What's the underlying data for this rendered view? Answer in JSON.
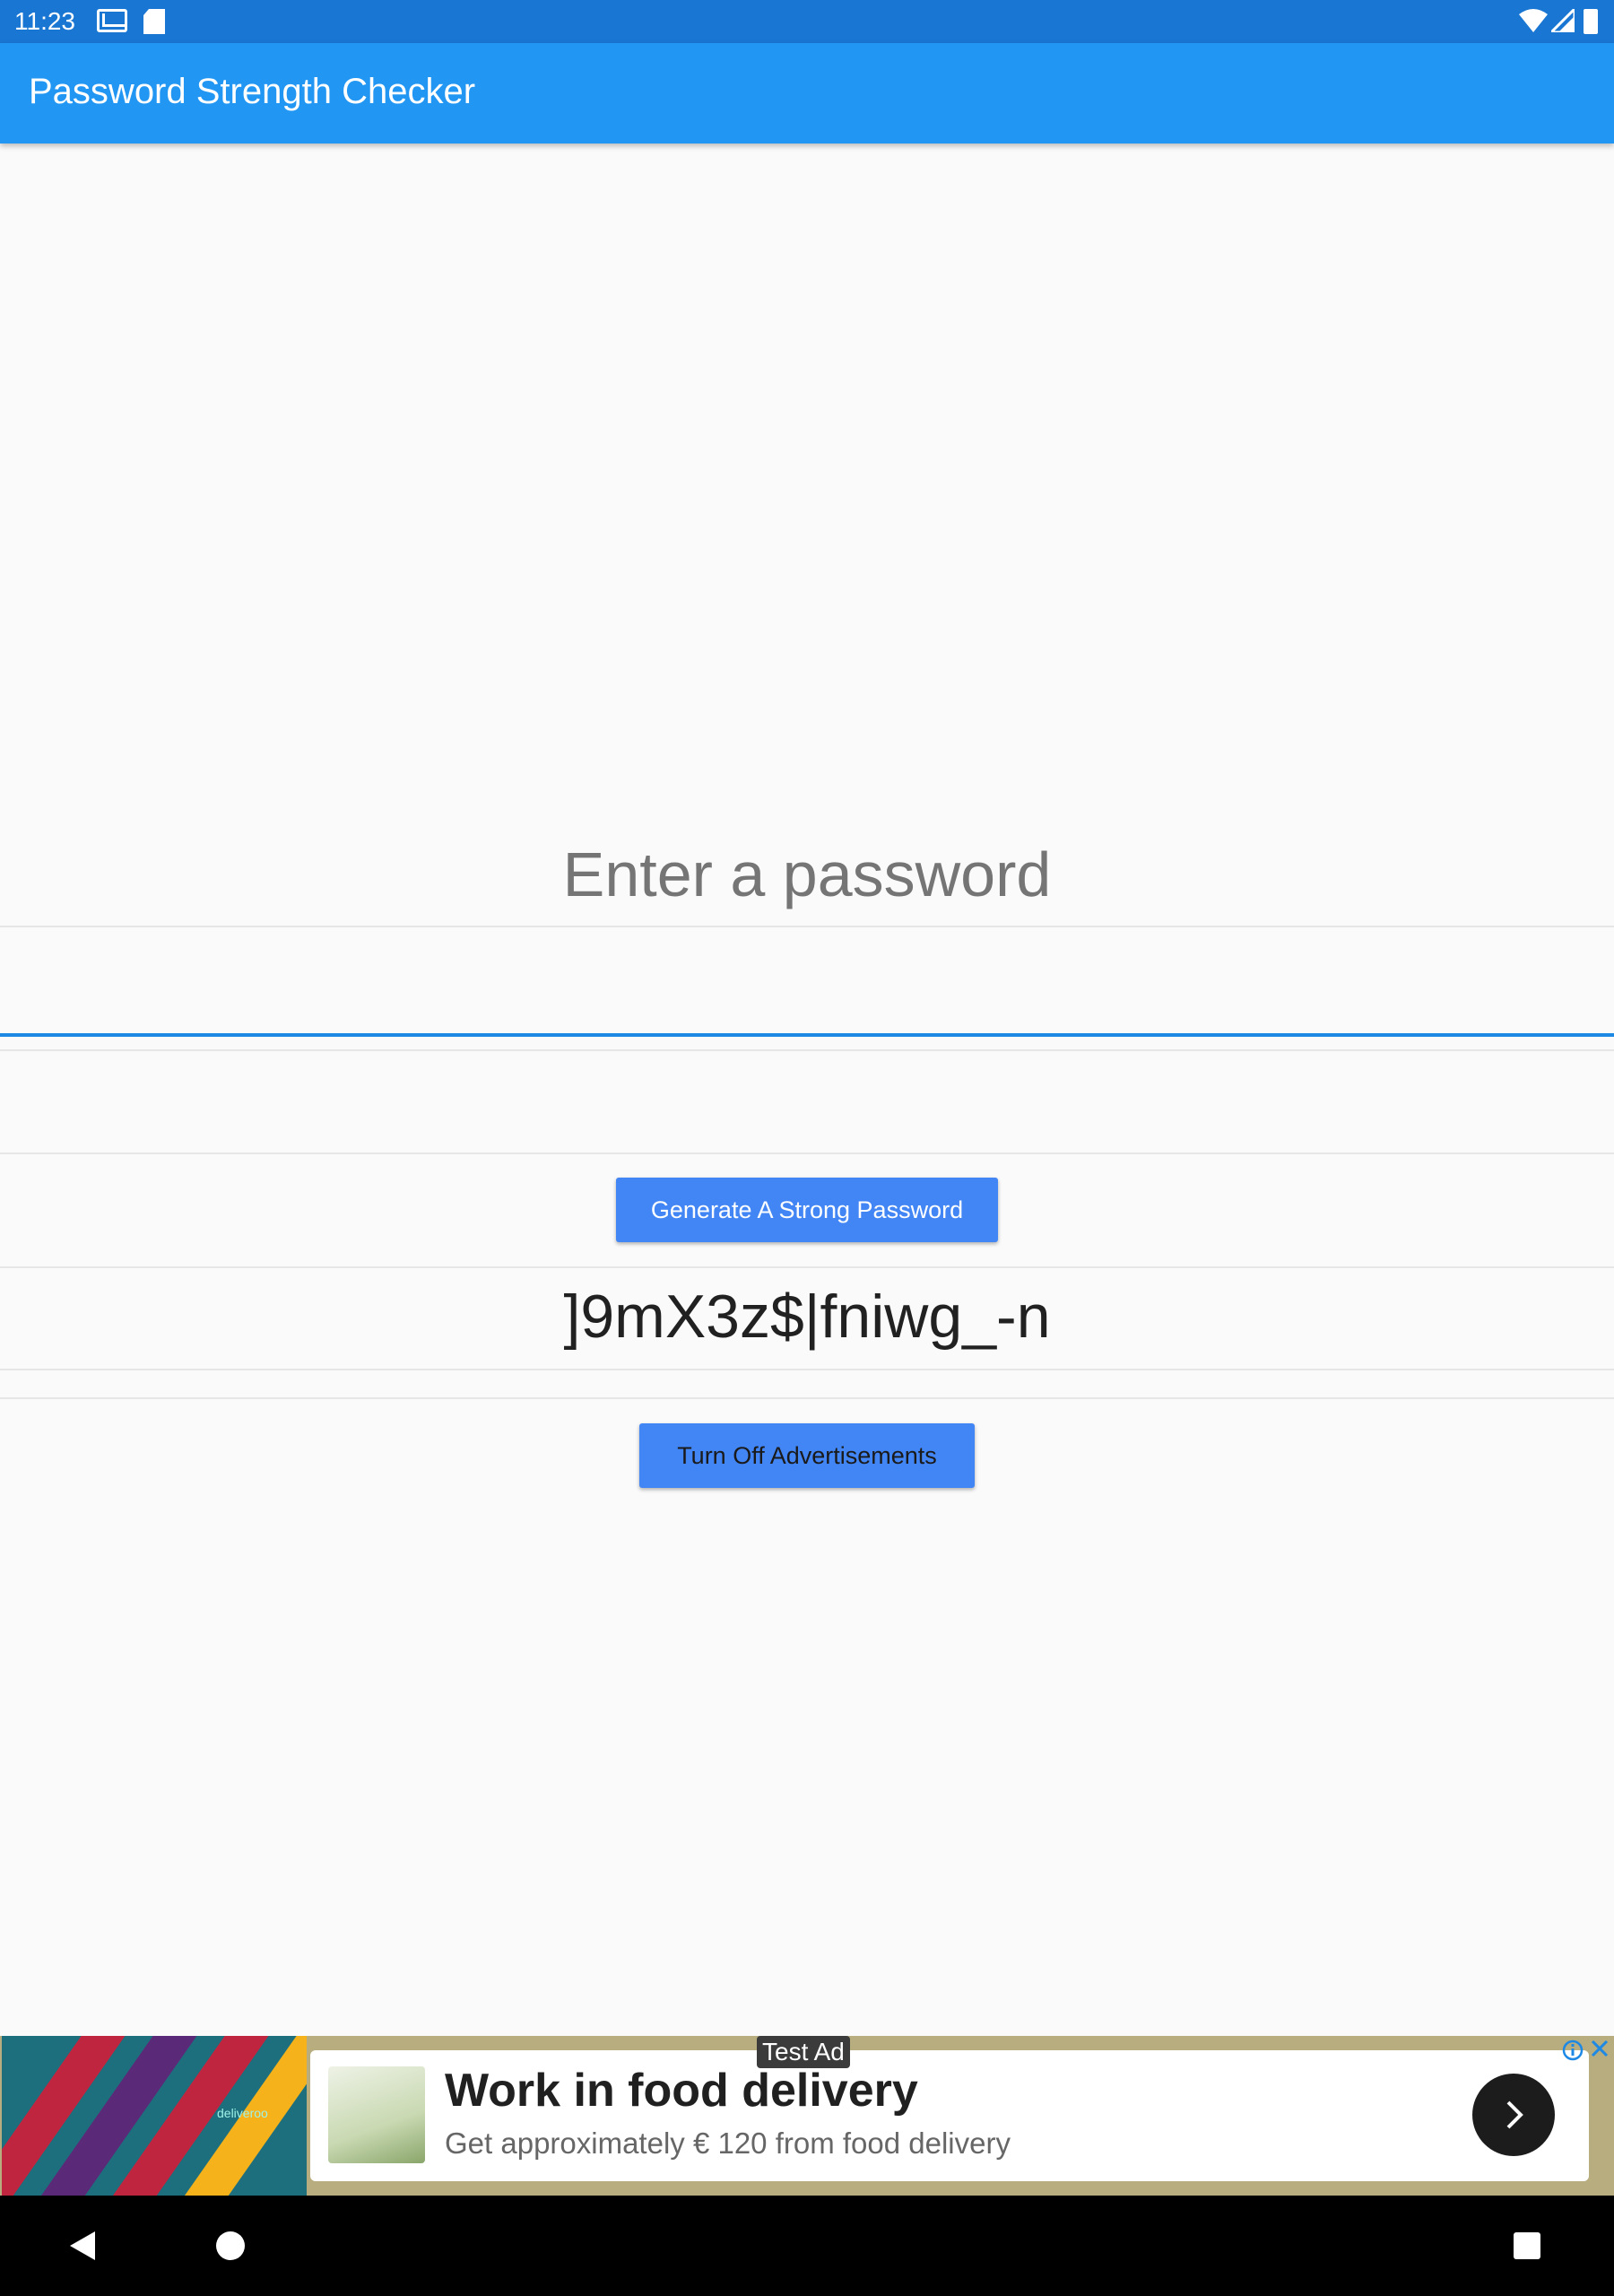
{
  "status_bar": {
    "time": "11:23",
    "left_icons": [
      "gmail-icon",
      "sd-card-icon"
    ],
    "right_icons": [
      "wifi-icon",
      "signal-icon",
      "battery-icon"
    ],
    "color": "#1976d2"
  },
  "app_bar": {
    "title": "Password Strength Checker",
    "color": "#2196f3"
  },
  "main": {
    "prompt": "Enter a password",
    "password_input": {
      "value": "",
      "placeholder": ""
    },
    "generate_button_label": "Generate A Strong Password",
    "generated_password": "]9mX3z$|fniwg_-n",
    "ads_button_label": "Turn Off Advertisements",
    "button_color": "#4285f4"
  },
  "ad": {
    "label": "Test Ad",
    "headline": "Work in food delivery",
    "description": "Get approximately € 120 from food delivery",
    "brand_logo_text": "deliveroo",
    "info_icon": "info-icon",
    "close_icon": "close-icon",
    "cta_icon": "chevron-right-icon"
  },
  "nav_bar": {
    "buttons": [
      "back-icon",
      "home-icon",
      "recents-icon"
    ]
  }
}
